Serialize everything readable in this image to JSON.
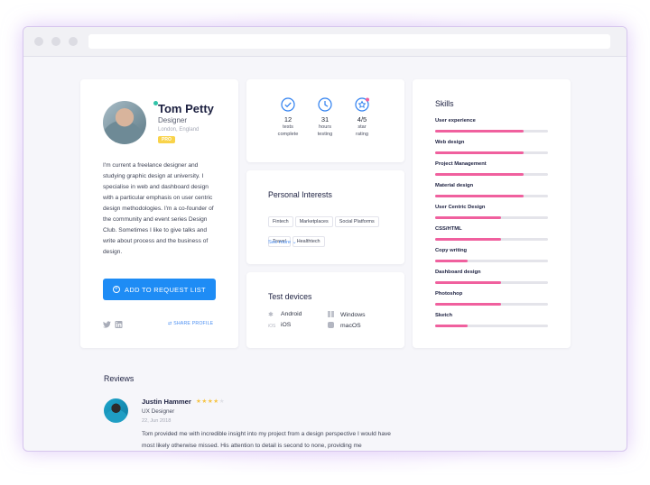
{
  "profile": {
    "name": "Tom Petty",
    "role": "Designer",
    "location": "London, England",
    "badge": "PRO",
    "bio": "I'm current a freelance designer and studying graphic design at university. I specialise in web and dashboard design with a particular emphasis on user centric design methodologies. I'm a co-founder of the community and event series Design Club. Sometimes I like to give talks and write about process and the business of design.",
    "add_button_label": "ADD TO REQUEST LIST",
    "share_label": "SHARE PROFILE"
  },
  "stats": [
    {
      "value": "12",
      "label1": "tests",
      "label2": "complete",
      "icon": "check-circle-icon"
    },
    {
      "value": "31",
      "label1": "hours",
      "label2": "testing",
      "icon": "clock-icon"
    },
    {
      "value": "4/5",
      "label1": "star",
      "label2": "rating",
      "icon": "star-badge-icon"
    }
  ],
  "interests": {
    "title": "Personal Interests",
    "tags": [
      "Fintech",
      "Marketplaces",
      "Social Platforms",
      "Travel",
      "Healthtech"
    ],
    "see_more": "See more"
  },
  "devices": {
    "title": "Test devices",
    "items": [
      "Android",
      "Windows",
      "iOS",
      "macOS"
    ]
  },
  "skills": {
    "title": "Skills",
    "items": [
      {
        "name": "User experience",
        "level": 0.78
      },
      {
        "name": "Web design",
        "level": 0.78
      },
      {
        "name": "Project Management",
        "level": 0.78
      },
      {
        "name": "Material design",
        "level": 0.78
      },
      {
        "name": "User Centric Design",
        "level": 0.58
      },
      {
        "name": "CSS/HTML",
        "level": 0.58
      },
      {
        "name": "Copy writing",
        "level": 0.29
      },
      {
        "name": "Dashboard design",
        "level": 0.58
      },
      {
        "name": "Photoshop",
        "level": 0.58
      },
      {
        "name": "Sketch",
        "level": 0.29
      }
    ]
  },
  "reviews": {
    "title": "Reviews",
    "items": [
      {
        "name": "Justin Hammer",
        "rating": 4,
        "role": "UX Designer",
        "date": "22, Jun 2018",
        "text": "Tom provided me with incredible insight into my project from a design perspective I would have most likely otherwise missed. His attention to detail is second to none, providing me"
      }
    ]
  },
  "colors": {
    "accent": "#1e8cf5",
    "skill_bar": "#f0609e",
    "badge": "#f9d34a",
    "star": "#f6c444"
  }
}
